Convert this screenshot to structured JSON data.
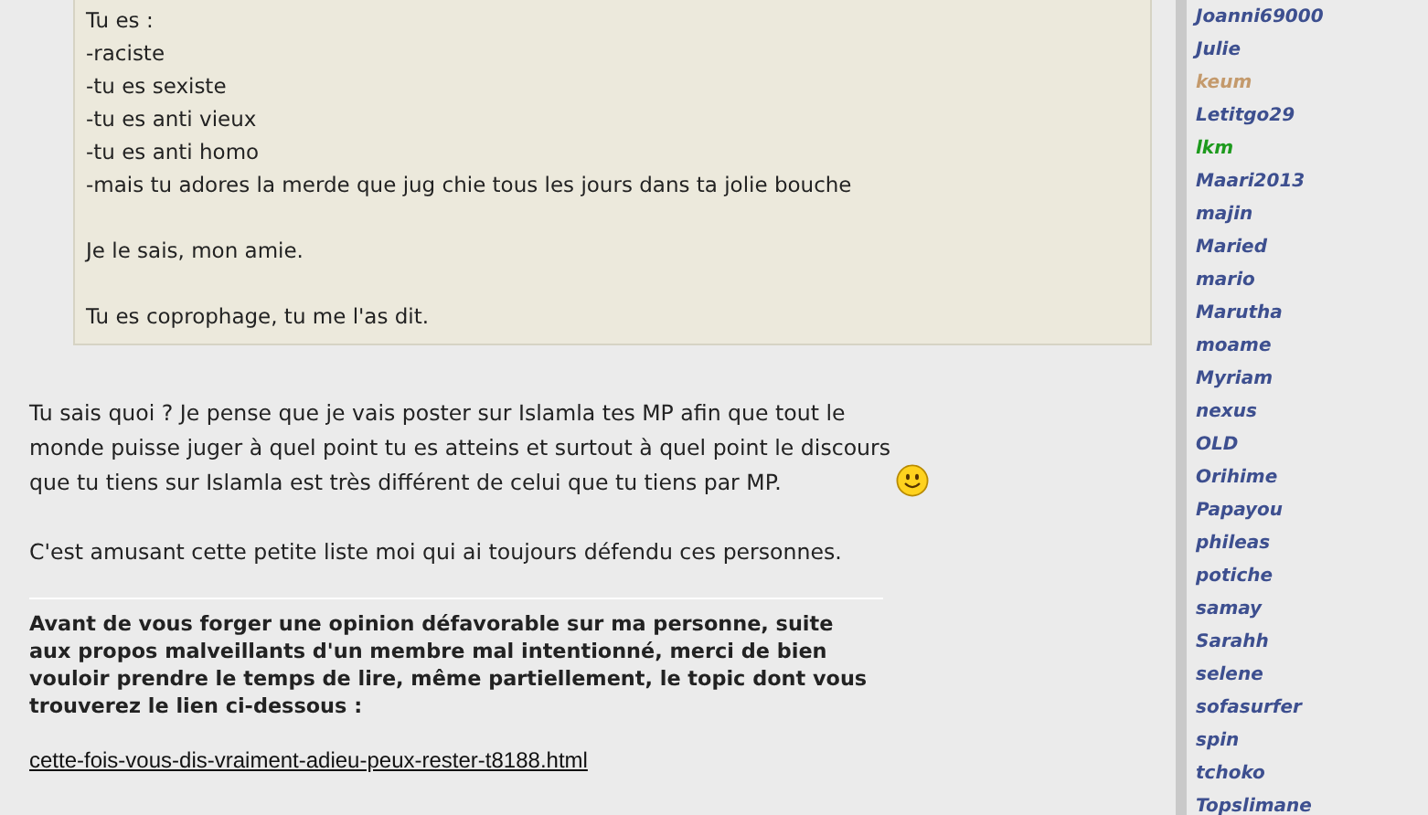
{
  "quote": {
    "blocks": [
      [
        "Tu es :",
        "-raciste",
        "-tu es sexiste",
        "-tu es anti vieux",
        "-tu es anti homo",
        "-mais tu adores la merde que jug chie tous les jours dans ta jolie bouche"
      ],
      [
        "Je le sais, mon amie."
      ],
      [
        "Tu es coprophage, tu me l'as dit."
      ]
    ]
  },
  "post": {
    "paragraphs": [
      "Tu sais quoi ? Je pense que je vais poster sur Islamla tes MP afin que tout le monde puisse juger à quel point tu es atteins et surtout à quel point le discours que tu tiens sur Islamla est très différent de celui que tu tiens par MP.",
      "C'est amusant cette petite liste moi qui ai toujours défendu ces personnes."
    ]
  },
  "signature": {
    "text": "Avant de vous forger une opinion défavorable sur ma personne, suite aux propos malveillants d'un membre mal intentionné, merci de bien vouloir prendre le temps de lire, même partiellement, le topic dont vous trouverez le lien ci-dessous :",
    "link": "cette-fois-vous-dis-vraiment-adieu-peux-rester-t8188.html"
  },
  "sidebar": {
    "members": [
      {
        "name": "Joanni69000",
        "color": "#3d4f8f"
      },
      {
        "name": "Julie",
        "color": "#3d4f8f"
      },
      {
        "name": "keum",
        "color": "#c49a6c"
      },
      {
        "name": "Letitgo29",
        "color": "#3d4f8f"
      },
      {
        "name": "lkm",
        "color": "#1d9a1d"
      },
      {
        "name": "Maari2013",
        "color": "#3d4f8f"
      },
      {
        "name": "majin",
        "color": "#3d4f8f"
      },
      {
        "name": "Maried",
        "color": "#3d4f8f"
      },
      {
        "name": "mario",
        "color": "#3d4f8f"
      },
      {
        "name": "Marutha",
        "color": "#3d4f8f"
      },
      {
        "name": "moame",
        "color": "#3d4f8f"
      },
      {
        "name": "Myriam",
        "color": "#3d4f8f"
      },
      {
        "name": "nexus",
        "color": "#3d4f8f"
      },
      {
        "name": "OLD",
        "color": "#3d4f8f"
      },
      {
        "name": "Orihime",
        "color": "#3d4f8f"
      },
      {
        "name": "Papayou",
        "color": "#3d4f8f"
      },
      {
        "name": "phileas",
        "color": "#3d4f8f"
      },
      {
        "name": "potiche",
        "color": "#3d4f8f"
      },
      {
        "name": "samay",
        "color": "#3d4f8f"
      },
      {
        "name": "Sarahh",
        "color": "#3d4f8f"
      },
      {
        "name": "selene",
        "color": "#3d4f8f"
      },
      {
        "name": "sofasurfer",
        "color": "#3d4f8f"
      },
      {
        "name": "spin",
        "color": "#3d4f8f"
      },
      {
        "name": "tchoko",
        "color": "#3d4f8f"
      },
      {
        "name": "Topslimane",
        "color": "#3d4f8f"
      }
    ]
  }
}
